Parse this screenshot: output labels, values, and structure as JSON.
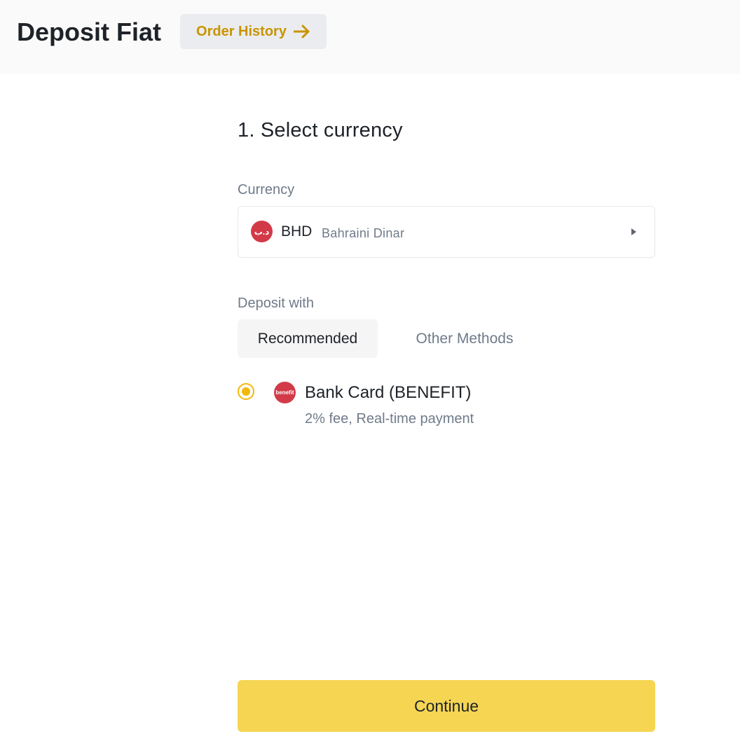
{
  "header": {
    "title": "Deposit Fiat",
    "order_history_label": "Order History",
    "order_history_icon": "arrow-right-icon"
  },
  "step": {
    "title": "1. Select currency"
  },
  "currency": {
    "label": "Currency",
    "selected_code": "BHD",
    "selected_name": "Bahraini Dinar",
    "icon_text": "د.ب",
    "icon": "bhd-currency-icon"
  },
  "deposit": {
    "label": "Deposit with",
    "tabs": [
      {
        "label": "Recommended",
        "active": true
      },
      {
        "label": "Other Methods",
        "active": false
      }
    ],
    "methods": [
      {
        "title": "Bank Card (BENEFIT)",
        "subtitle": "2% fee, Real-time payment",
        "icon": "benefit-logo-icon",
        "icon_text": "benefit",
        "selected": true
      }
    ]
  },
  "continue_label": "Continue",
  "colors": {
    "accent": "#f0b90b",
    "button": "#f5d552",
    "link": "#c99400",
    "brand_red": "#d33a48"
  }
}
